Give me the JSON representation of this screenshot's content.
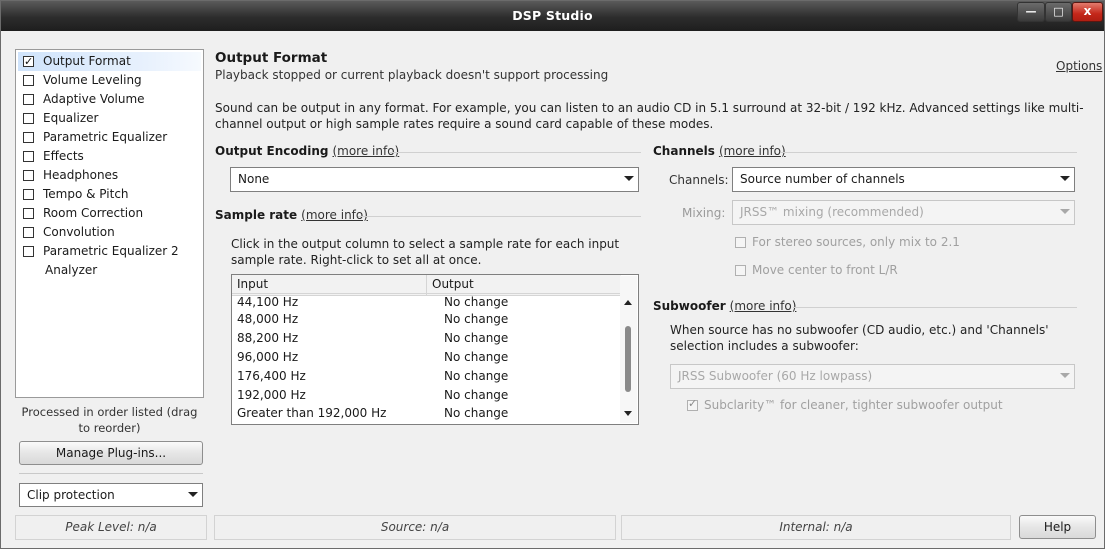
{
  "window": {
    "title": "DSP Studio",
    "minimize": "—",
    "maximize": "□",
    "close": "x"
  },
  "sidebar": {
    "items": [
      {
        "label": "Output Format",
        "checked": true,
        "has_checkbox": true,
        "selected": true
      },
      {
        "label": "Volume Leveling",
        "checked": false,
        "has_checkbox": true
      },
      {
        "label": "Adaptive Volume",
        "checked": false,
        "has_checkbox": true
      },
      {
        "label": "Equalizer",
        "checked": false,
        "has_checkbox": true
      },
      {
        "label": "Parametric Equalizer",
        "checked": false,
        "has_checkbox": true
      },
      {
        "label": "Effects",
        "checked": false,
        "has_checkbox": true
      },
      {
        "label": "Headphones",
        "checked": false,
        "has_checkbox": true
      },
      {
        "label": "Tempo & Pitch",
        "checked": false,
        "has_checkbox": true
      },
      {
        "label": "Room Correction",
        "checked": false,
        "has_checkbox": true
      },
      {
        "label": "Convolution",
        "checked": false,
        "has_checkbox": true
      },
      {
        "label": "Parametric Equalizer 2",
        "checked": false,
        "has_checkbox": true
      },
      {
        "label": "Analyzer",
        "checked": false,
        "has_checkbox": false
      }
    ],
    "order_note": "Processed in order listed (drag to reorder)",
    "manage_plugins": "Manage Plug-ins...",
    "clip_protection": "Clip protection"
  },
  "status": {
    "peak": "Peak Level: n/a",
    "source": "Source: n/a",
    "internal": "Internal: n/a",
    "help": "Help"
  },
  "main": {
    "title": "Output Format",
    "subtitle": "Playback stopped or current playback doesn't support processing",
    "options": "Options",
    "description": "Sound can be output in any format.  For example, you can listen to an audio CD in 5.1 surround at 32-bit / 192 kHz.  Advanced settings like multi-channel output or high sample rates require a sound card capable of these modes.",
    "more_info": "(more info)",
    "encoding": {
      "heading": "Output Encoding",
      "value": "None"
    },
    "sample_rate": {
      "heading": "Sample rate",
      "description": "Click in the output column to select a sample rate for each input sample rate.  Right-click to set all at once.",
      "columns": [
        "Input",
        "Output"
      ],
      "rows": [
        [
          "44,100 Hz",
          "No change"
        ],
        [
          "48,000 Hz",
          "No change"
        ],
        [
          "88,200 Hz",
          "No change"
        ],
        [
          "96,000 Hz",
          "No change"
        ],
        [
          "176,400 Hz",
          "No change"
        ],
        [
          "192,000 Hz",
          "No change"
        ],
        [
          "Greater than 192,000 Hz",
          "No change"
        ]
      ]
    },
    "channels": {
      "heading": "Channels",
      "channels_label": "Channels:",
      "channels_value": "Source number of channels",
      "mixing_label": "Mixing:",
      "mixing_value": "JRSS™ mixing (recommended)",
      "stereo_option": "For stereo sources, only mix to 2.1",
      "center_option": "Move center to front L/R"
    },
    "subwoofer": {
      "heading": "Subwoofer",
      "description": "When source has no subwoofer (CD audio, etc.) and 'Channels' selection includes a subwoofer:",
      "value": "JRSS Subwoofer (60 Hz lowpass)",
      "subclarity": "Subclarity™ for cleaner, tighter subwoofer output",
      "subclarity_checked": true
    }
  }
}
